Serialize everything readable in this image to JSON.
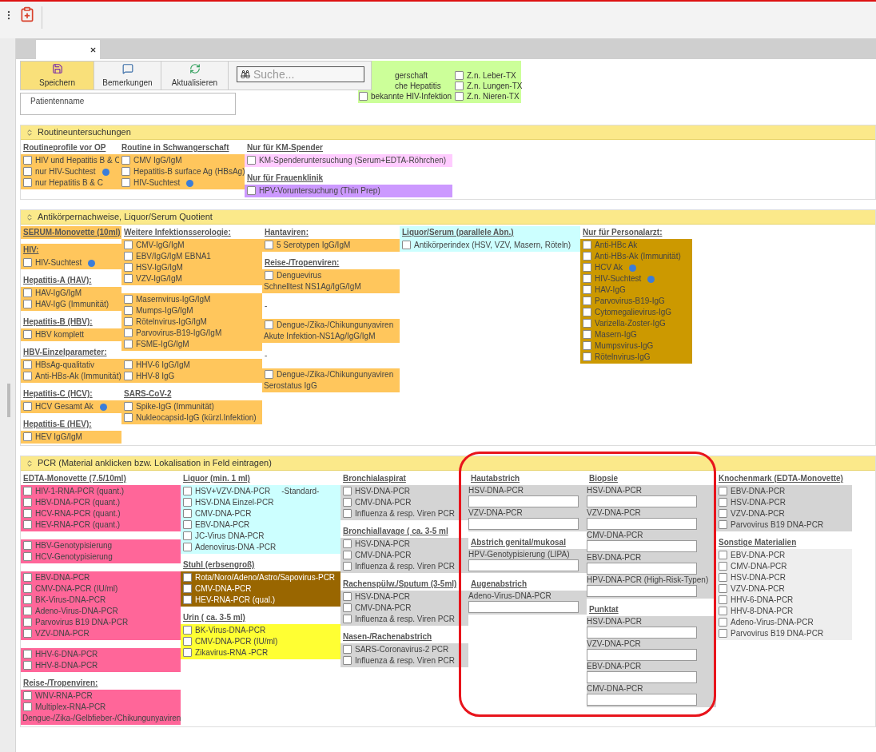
{
  "toolbar": {
    "buttons": [
      {
        "label": "Speichern",
        "kind": "save",
        "primary": true
      },
      {
        "label": "Bemerkungen",
        "kind": "comment",
        "primary": false
      },
      {
        "label": "Aktualisieren",
        "kind": "refresh",
        "primary": false
      }
    ],
    "search": {
      "placeholder": "Suche..."
    }
  },
  "patient": {
    "label": "Patientenname"
  },
  "risk_panel": {
    "color": "#ccff99",
    "columns": [
      [
        {
          "label": "gerschaft"
        },
        {
          "label": "che Hepatitis"
        },
        {
          "label": "bekannte HIV-Infektion",
          "checked": false
        }
      ],
      [
        {
          "label": "Z.n. Leber-TX",
          "checked": false
        },
        {
          "label": "Z.n. Lungen-TX",
          "checked": false
        },
        {
          "label": "Z.n. Nieren-TX",
          "checked": false
        }
      ]
    ]
  },
  "sections": [
    {
      "title": "Routineuntersuchungen",
      "columns": [
        [
          {
            "kind": "heading",
            "text": "Routineprofile vor OP"
          },
          {
            "kind": "checks",
            "color": "#ffc65c",
            "items": [
              {
                "label": "HIV und Hepatitis B & C",
                "checked": false
              },
              {
                "label": "nur HIV-Suchtest",
                "checked": false,
                "info": true
              },
              {
                "label": "nur Hepatitis B & C",
                "checked": false
              }
            ]
          }
        ],
        [
          {
            "kind": "heading",
            "text": "Routine in Schwangerschaft"
          },
          {
            "kind": "checks",
            "color": "#ffc65c",
            "items": [
              {
                "label": "CMV IgG/IgM",
                "checked": false
              },
              {
                "label": "Hepatitis-B surface Ag (HBsAg)",
                "checked": false
              },
              {
                "label": "HIV-Suchtest",
                "checked": false,
                "info": true
              }
            ]
          }
        ],
        [
          {
            "kind": "heading",
            "text": "Nur für KM-Spender"
          },
          {
            "kind": "checks",
            "color": "#ffccff",
            "items": [
              {
                "label": "KM-Spenderuntersuchung (Serum+EDTA-Röhrchen)",
                "checked": false
              }
            ]
          },
          {
            "kind": "heading",
            "text": "Nur für Frauenklinik"
          },
          {
            "kind": "checks",
            "color": "#cc99ff",
            "items": [
              {
                "label": "HPV-Voruntersuchung (Thin Prep)",
                "checked": false
              }
            ]
          }
        ]
      ]
    },
    {
      "title": "Antikörpernachweise, Liquor/Serum Quotient",
      "columns": [
        [
          {
            "kind": "heading",
            "text": "SERUM-Monovette (10ml)",
            "color": "#ffc65c"
          },
          {
            "kind": "heading",
            "text": "HIV:",
            "color": "#ffc65c"
          },
          {
            "kind": "checks",
            "color": "#ffc65c",
            "items": [
              {
                "label": "HIV-Suchtest",
                "checked": false,
                "info": true
              }
            ]
          },
          {
            "kind": "heading",
            "text": "Hepatitis-A (HAV):"
          },
          {
            "kind": "checks",
            "color": "#ffc65c",
            "items": [
              {
                "label": "HAV-IgG/IgM",
                "checked": false
              },
              {
                "label": "HAV-IgG (Immunität)",
                "checked": false
              }
            ]
          },
          {
            "kind": "heading",
            "text": "Hepatitis-B (HBV):"
          },
          {
            "kind": "checks",
            "color": "#ffc65c",
            "items": [
              {
                "label": "HBV komplett",
                "checked": false
              }
            ]
          },
          {
            "kind": "heading",
            "text": "HBV-Einzelparameter:"
          },
          {
            "kind": "checks",
            "color": "#ffc65c",
            "items": [
              {
                "label": "HBsAg-qualitativ",
                "checked": false
              },
              {
                "label": "Anti-HBs-Ak (Immunität)",
                "checked": false
              }
            ]
          },
          {
            "kind": "heading",
            "text": "Hepatitis-C (HCV):"
          },
          {
            "kind": "checks",
            "color": "#ffc65c",
            "items": [
              {
                "label": "HCV Gesamt Ak",
                "checked": false,
                "info": true
              }
            ]
          },
          {
            "kind": "heading",
            "text": "Hepatitis-E (HEV):"
          },
          {
            "kind": "checks",
            "color": "#ffc65c",
            "items": [
              {
                "label": "HEV IgG/IgM",
                "checked": false
              }
            ]
          }
        ],
        [
          {
            "kind": "heading",
            "text": "Weitere Infektionsserologie:"
          },
          {
            "kind": "checks",
            "color": "#ffc65c",
            "items": [
              {
                "label": "CMV-IgG/IgM",
                "checked": false
              },
              {
                "label": "EBV/IgG/IgM EBNA1",
                "checked": false
              },
              {
                "label": "HSV-IgG/IgM",
                "checked": false
              },
              {
                "label": "VZV-IgG/IgM",
                "checked": false
              }
            ]
          },
          {
            "kind": "checks",
            "color": "#ffc65c",
            "items": [
              {
                "label": "Masernvirus-IgG/IgM",
                "checked": false
              },
              {
                "label": "Mumps-IgG/IgM",
                "checked": false
              },
              {
                "label": "Rötelnvirus-IgG/IgM",
                "checked": false
              },
              {
                "label": "Parvovirus-B19-IgG/IgM",
                "checked": false
              },
              {
                "label": "FSME-IgG/IgM",
                "checked": false
              }
            ]
          },
          {
            "kind": "checks",
            "color": "#ffc65c",
            "items": [
              {
                "label": "HHV-6 IgG/IgM",
                "checked": false
              },
              {
                "label": "HHV-8 IgG",
                "checked": false
              }
            ]
          },
          {
            "kind": "heading",
            "text": "SARS-CoV-2"
          },
          {
            "kind": "checks",
            "color": "#ffc65c",
            "items": [
              {
                "label": "Spike-IgG (Immunität)",
                "checked": false
              },
              {
                "label": "Nukleocapsid-IgG (kürzl.Infektion)",
                "checked": false
              }
            ]
          }
        ],
        [
          {
            "kind": "heading",
            "text": "Hantaviren:"
          },
          {
            "kind": "checks",
            "color": "#ffc65c",
            "items": [
              {
                "label": "5 Serotypen IgG/IgM",
                "checked": false
              }
            ]
          },
          {
            "kind": "heading",
            "text": "Reise-/Tropenviren:"
          },
          {
            "kind": "checks",
            "color": "#ffc65c",
            "items": [
              {
                "kind": "check",
                "label": "Denguevirus",
                "checked": false
              },
              {
                "kind": "note",
                "label": "Schnelltest NS1Ag/IgG/IgM"
              }
            ]
          },
          {
            "kind": "text",
            "text": "-"
          },
          {
            "kind": "checks",
            "color": "#ffc65c",
            "items": [
              {
                "kind": "check",
                "label": "Dengue-/Zika-/Chikungunyaviren",
                "checked": false
              },
              {
                "kind": "note",
                "label": "Akute Infektion-NS1Ag/IgG/IgM"
              }
            ]
          },
          {
            "kind": "text",
            "text": "-"
          },
          {
            "kind": "checks",
            "color": "#ffc65c",
            "items": [
              {
                "kind": "check",
                "label": "Dengue-/Zika-/Chikungunyaviren",
                "checked": false
              },
              {
                "kind": "note",
                "label": "Serostatus IgG"
              }
            ]
          }
        ],
        [
          {
            "kind": "heading",
            "text": "Liquor/Serum (parallele Abn.)",
            "color": "#ccffff"
          },
          {
            "kind": "checks",
            "color": "#ccffff",
            "items": [
              {
                "label": "Antikörperindex (HSV, VZV, Masern, Röteln)",
                "checked": false
              }
            ]
          }
        ],
        [
          {
            "kind": "heading",
            "text": "Nur für Personalarzt:"
          },
          {
            "kind": "checks",
            "color": "#cc9900",
            "items": [
              {
                "label": "Anti-HBc Ak",
                "checked": false
              },
              {
                "label": "Anti-HBs-Ak (Immunität)",
                "checked": false
              },
              {
                "label": "HCV  Ak",
                "checked": false,
                "info": true
              },
              {
                "label": "HIV-Suchtest",
                "checked": false,
                "info": true
              },
              {
                "label": "HAV-IgG",
                "checked": false
              },
              {
                "label": "Parvovirus-B19-IgG",
                "checked": false
              },
              {
                "label": "Cytomegalievirus-IgG",
                "checked": false
              },
              {
                "label": "Varizella-Zoster-IgG",
                "checked": false
              },
              {
                "label": "Masern-IgG",
                "checked": false
              },
              {
                "label": "Mumpsvirus-IgG",
                "checked": false
              },
              {
                "label": "Rötelnvirus-IgG",
                "checked": false
              }
            ]
          }
        ]
      ]
    },
    {
      "title": "PCR (Material anklicken bzw. Lokalisation in Feld eintragen)",
      "highlight": true,
      "columns": [
        [
          {
            "kind": "heading",
            "text": "EDTA-Monovette (7.5/10ml)"
          },
          {
            "kind": "checks",
            "color": "#ff6699",
            "items": [
              {
                "label": "HIV-1-RNA-PCR (quant.)",
                "checked": false
              },
              {
                "label": "HBV-DNA-PCR (quant.)",
                "checked": false
              },
              {
                "label": "HCV-RNA-PCR (quant.)",
                "checked": false
              },
              {
                "label": "HEV-RNA-PCR (quant.)",
                "checked": false
              }
            ]
          },
          {
            "kind": "checks",
            "color": "#ff6699",
            "items": [
              {
                "label": "HBV-Genotypisierung",
                "checked": false
              },
              {
                "label": "HCV-Genotypisierung",
                "checked": false
              }
            ]
          },
          {
            "kind": "checks",
            "color": "#ff6699",
            "items": [
              {
                "label": "EBV-DNA-PCR",
                "checked": false
              },
              {
                "label": "CMV-DNA-PCR (IU/ml)",
                "checked": false
              },
              {
                "label": "BK-Virus-DNA-PCR",
                "checked": false
              },
              {
                "label": "Adeno-Virus-DNA-PCR",
                "checked": false
              },
              {
                "label": "Parvovirus B19 DNA-PCR",
                "checked": false
              },
              {
                "label": "VZV-DNA-PCR",
                "checked": false
              }
            ]
          },
          {
            "kind": "checks",
            "color": "#ff6699",
            "items": [
              {
                "label": "HHV-6-DNA-PCR",
                "checked": false
              },
              {
                "label": "HHV-8-DNA-PCR",
                "checked": false
              }
            ]
          },
          {
            "kind": "heading",
            "text": "Reise-/Tropenviren:"
          },
          {
            "kind": "checks",
            "color": "#ff6699",
            "items": [
              {
                "kind": "check",
                "label": "WNV-RNA-PCR",
                "checked": false
              },
              {
                "kind": "check",
                "label": "Multiplex-RNA-PCR",
                "checked": false
              },
              {
                "kind": "note",
                "label": "Dengue-/Zika-/Gelbfieber-/Chikungunyaviren"
              }
            ]
          }
        ],
        [
          {
            "kind": "heading",
            "text": "Liquor (min. 1 ml)"
          },
          {
            "kind": "checks",
            "color": "#ccffff",
            "items": [
              {
                "label": "HSV+VZV-DNA-PCR",
                "checked": false,
                "tag": "-Standard-"
              },
              {
                "label": "HSV-DNA Einzel-PCR",
                "checked": false
              },
              {
                "label": "CMV-DNA-PCR",
                "checked": false
              },
              {
                "label": "EBV-DNA-PCR",
                "checked": false
              },
              {
                "label": "JC-Virus DNA-PCR",
                "checked": false
              },
              {
                "label": "Adenovirus-DNA -PCR",
                "checked": false
              }
            ]
          },
          {
            "kind": "heading",
            "text": "Stuhl (erbsengroß)"
          },
          {
            "kind": "checks",
            "color": "#996600",
            "items": [
              {
                "label": "Rota/Noro/Adeno/Astro/Sapovirus-PCR",
                "checked": false
              },
              {
                "label": "CMV-DNA-PCR",
                "checked": false
              },
              {
                "label": "HEV-RNA-PCR (qual.)",
                "checked": false
              }
            ]
          },
          {
            "kind": "heading",
            "text": "Urin ( ca. 3-5 ml)"
          },
          {
            "kind": "checks",
            "color": "#ffff33",
            "items": [
              {
                "label": "BK-Virus-DNA-PCR",
                "checked": false
              },
              {
                "label": "CMV-DNA-PCR (IU/ml)",
                "checked": false
              },
              {
                "label": "Zikavirus-RNA -PCR",
                "checked": false
              }
            ]
          }
        ],
        [
          {
            "kind": "heading",
            "text": "Bronchialaspirat"
          },
          {
            "kind": "checks",
            "color": "#d4d4d4",
            "items": [
              {
                "label": "HSV-DNA-PCR",
                "checked": false
              },
              {
                "label": "CMV-DNA-PCR",
                "checked": false
              },
              {
                "label": "Influenza & resp. Viren PCR",
                "checked": false
              }
            ]
          },
          {
            "kind": "heading",
            "text": "Bronchiallavage ( ca. 3-5 ml"
          },
          {
            "kind": "checks",
            "color": "#d4d4d4",
            "items": [
              {
                "label": "HSV-DNA-PCR",
                "checked": false
              },
              {
                "label": "CMV-DNA-PCR",
                "checked": false
              },
              {
                "label": "Influenza & resp. Viren PCR",
                "checked": false
              }
            ]
          },
          {
            "kind": "heading",
            "text": "Rachenspülw./Sputum (3-5ml)"
          },
          {
            "kind": "checks",
            "color": "#d4d4d4",
            "items": [
              {
                "label": "HSV-DNA-PCR",
                "checked": false
              },
              {
                "label": "CMV-DNA-PCR",
                "checked": false
              },
              {
                "label": "Influenza & resp. Viren PCR",
                "checked": false
              }
            ]
          },
          {
            "kind": "heading",
            "text": "Nasen-/Rachenabstrich"
          },
          {
            "kind": "checks",
            "color": "#d4d4d4",
            "items": [
              {
                "label": "SARS-Coronavirus-2 PCR",
                "checked": false
              },
              {
                "label": "Influenza & resp. Viren PCR",
                "checked": false
              }
            ]
          }
        ],
        [
          {
            "kind": "heading",
            "text": "Hautabstrich"
          },
          {
            "kind": "fields",
            "items": [
              {
                "label": "HSV-DNA-PCR"
              },
              {
                "label": "VZV-DNA-PCR"
              }
            ]
          },
          {
            "kind": "heading",
            "text": "Abstrich genital/mukosal"
          },
          {
            "kind": "fields",
            "items": [
              {
                "label": "HPV-Genotypisierung (LIPA)"
              }
            ]
          },
          {
            "kind": "heading",
            "text": "Augenabstrich"
          },
          {
            "kind": "fields",
            "items": [
              {
                "label": "Adeno-Virus-DNA-PCR"
              }
            ]
          }
        ],
        [
          {
            "kind": "heading",
            "text": "Biopsie"
          },
          {
            "kind": "fields",
            "items": [
              {
                "label": "HSV-DNA-PCR"
              },
              {
                "label": "VZV-DNA-PCR"
              },
              {
                "label": "CMV-DNA-PCR"
              },
              {
                "label": "EBV-DNA-PCR"
              },
              {
                "label": "HPV-DNA-PCR (High-Risk-Typen)"
              }
            ]
          },
          {
            "kind": "heading",
            "text": "Punktat"
          },
          {
            "kind": "fields",
            "items": [
              {
                "label": "HSV-DNA-PCR"
              },
              {
                "label": "VZV-DNA-PCR"
              },
              {
                "label": "EBV-DNA-PCR"
              },
              {
                "label": "CMV-DNA-PCR"
              }
            ]
          }
        ],
        [
          {
            "kind": "heading",
            "text": "Knochenmark (EDTA-Monovette)"
          },
          {
            "kind": "checks",
            "color": "#d4d4d4",
            "items": [
              {
                "label": "EBV-DNA-PCR",
                "checked": false
              },
              {
                "label": "HSV-DNA-PCR",
                "checked": false
              },
              {
                "label": "VZV-DNA-PCR",
                "checked": false
              },
              {
                "label": "Parvovirus B19 DNA-PCR",
                "checked": false
              }
            ]
          },
          {
            "kind": "heading",
            "text": "Sonstige Materialien"
          },
          {
            "kind": "checks",
            "color": "#eeeeee",
            "items": [
              {
                "label": "EBV-DNA-PCR",
                "checked": false
              },
              {
                "label": "CMV-DNA-PCR",
                "checked": false
              },
              {
                "label": "HSV-DNA-PCR",
                "checked": false
              },
              {
                "label": "VZV-DNA-PCR",
                "checked": false
              },
              {
                "label": "HHV-6-DNA-PCR",
                "checked": false
              },
              {
                "label": "HHV-8-DNA-PCR",
                "checked": false
              },
              {
                "label": "Adeno-Virus-DNA-PCR",
                "checked": false
              },
              {
                "label": "Parvovirus B19 DNA-PCR",
                "checked": false
              }
            ]
          }
        ]
      ]
    }
  ]
}
